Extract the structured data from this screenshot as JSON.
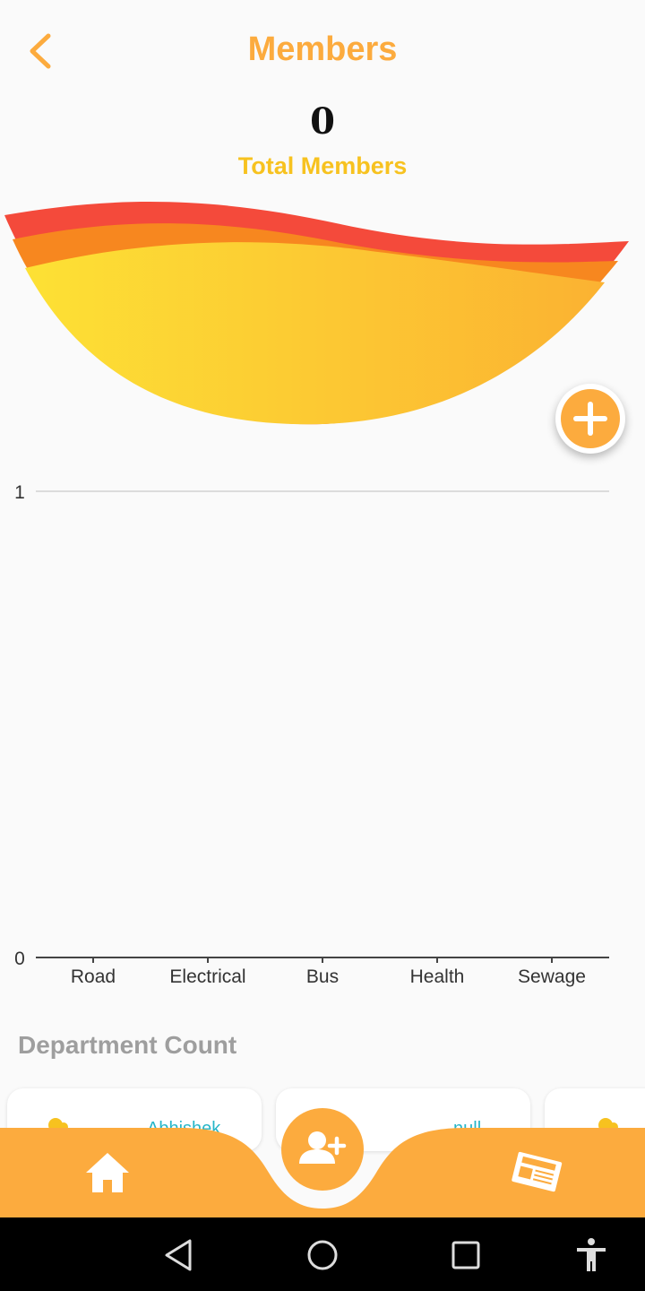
{
  "header": {
    "title": "Members"
  },
  "summary": {
    "total_count": "0",
    "total_label": "Total Members"
  },
  "section": {
    "department_title": "Department Count"
  },
  "cards": [
    {
      "name": "Abhishek"
    },
    {
      "name": "null"
    },
    {
      "name": ""
    }
  ],
  "colors": {
    "accent": "#fcab3e",
    "total_label": "#f7c21f",
    "card_name": "#26b6c8",
    "wave_red": "#f44a3b",
    "wave_orange": "#f7871f",
    "wave_yellow": "#fcd72e"
  },
  "icons": {
    "back": "chevron-left-icon",
    "fab": "plus-icon",
    "home": "home-icon",
    "add_member": "add-person-icon",
    "news": "newspaper-icon",
    "sys_back": "triangle-back-icon",
    "sys_home": "circle-home-icon",
    "sys_recents": "square-recents-icon",
    "sys_accessibility": "accessibility-icon"
  },
  "chart_data": {
    "type": "bar",
    "categories": [
      "Road",
      "Electrical",
      "Bus",
      "Health",
      "Sewage"
    ],
    "series": [
      {
        "values": [
          0,
          0,
          0,
          0,
          0
        ]
      }
    ],
    "y_ticks": [
      "0",
      "1"
    ],
    "ylim": [
      0,
      1
    ],
    "title": "",
    "xlabel": "",
    "ylabel": "",
    "grid": true
  }
}
